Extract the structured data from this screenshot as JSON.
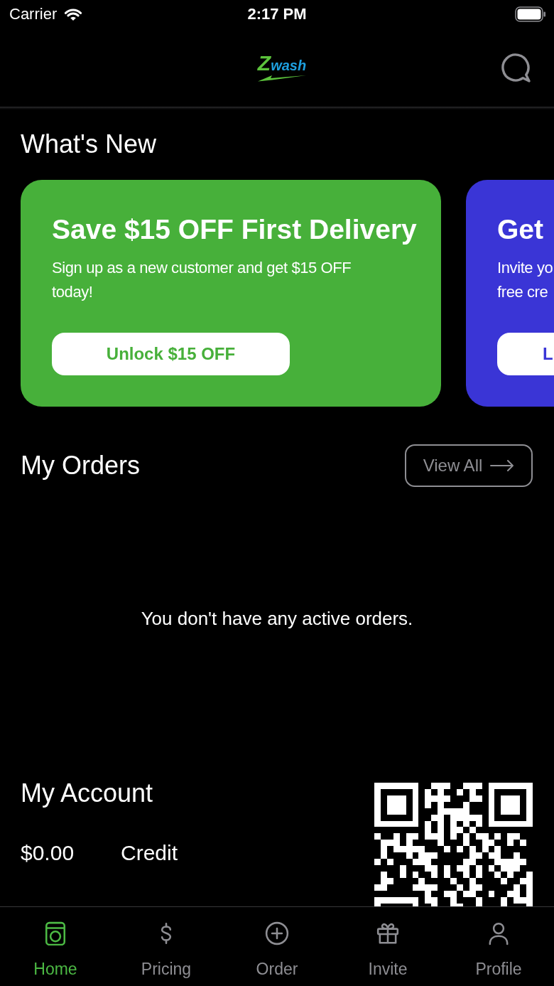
{
  "status_bar": {
    "carrier": "Carrier",
    "time": "2:17 PM"
  },
  "header": {
    "logo": {
      "initial": "Z",
      "rest": "wash"
    }
  },
  "whats_new": {
    "title": "What's New",
    "promos": [
      {
        "title": "Save $15 OFF First Delivery",
        "text": "Sign up as a new customer and get $15 OFF today!",
        "button": "Unlock $15 OFF",
        "color": "#47b03a"
      },
      {
        "title": "Get",
        "text": "Invite yo\nfree cre",
        "button": "L",
        "color": "#3a35d6"
      }
    ]
  },
  "orders": {
    "title": "My Orders",
    "view_all": "View All",
    "empty_message": "You don't have any active orders."
  },
  "account": {
    "title": "My Account",
    "balance": "$0.00",
    "balance_label": "Credit"
  },
  "tabs": [
    {
      "label": "Home",
      "selected": true
    },
    {
      "label": "Pricing",
      "selected": false
    },
    {
      "label": "Order",
      "selected": false
    },
    {
      "label": "Invite",
      "selected": false
    },
    {
      "label": "Profile",
      "selected": false
    }
  ]
}
